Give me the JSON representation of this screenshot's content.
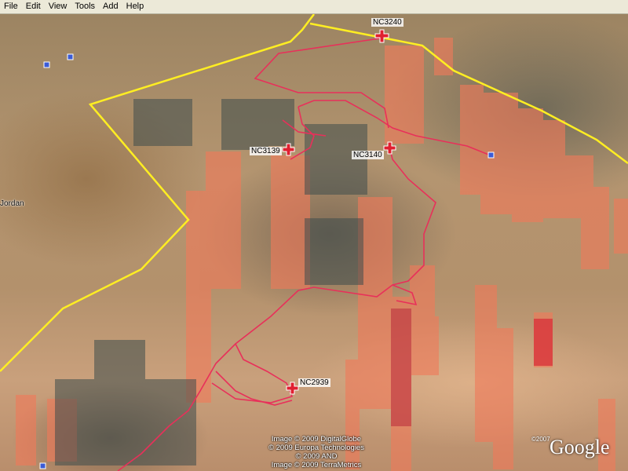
{
  "menu": {
    "items": [
      "File",
      "Edit",
      "View",
      "Tools",
      "Add",
      "Help"
    ]
  },
  "map": {
    "place_label": "Jordan",
    "markers": [
      {
        "id": "NC3240"
      },
      {
        "id": "NC3139"
      },
      {
        "id": "NC3140"
      },
      {
        "id": "NC2939"
      }
    ],
    "credits": [
      "Image © 2009 DigitalGlobe",
      "© 2009 Europa Technologies",
      "© 2009 AND",
      "Image © 2009 TerraMetrics"
    ],
    "logo": {
      "text": "Google",
      "year": "©2007"
    },
    "colors": {
      "border_line": "#ffee22",
      "route_line": "#e8305a",
      "marker": "#e02030",
      "overlay_tile": "#f07a5a"
    }
  }
}
